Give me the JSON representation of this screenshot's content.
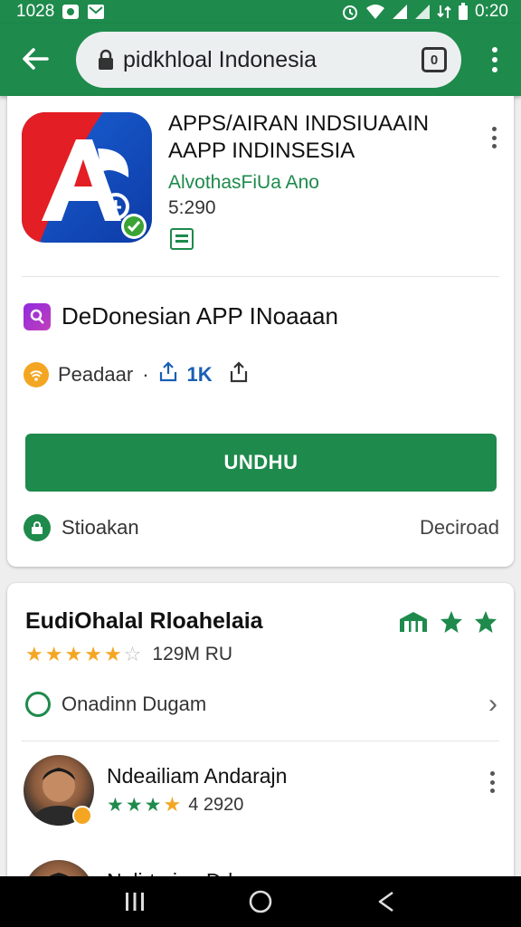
{
  "status_bar": {
    "left_time": "1028",
    "right_time": "0:20"
  },
  "toolbar": {
    "url": "pidkhloal Indonesia",
    "tabs_count": "0"
  },
  "app": {
    "title_line1": "APPS/AIRAN INDSIUAAIN",
    "title_line2": "AAPP INDINSESIA",
    "developer": "AlvothasFiUa Ano",
    "size": "5:290"
  },
  "developer_row": {
    "label": "DeDonesian APP INoaaan"
  },
  "meta_row": {
    "label": "Peadaar",
    "separator": "·",
    "stat": "1K"
  },
  "install_button": {
    "label": "UNDHU"
  },
  "bottom_row": {
    "left": "Stioakan",
    "right": "Deciroad"
  },
  "reviews": {
    "title": "EudiOhalal Rloahelaia",
    "rating": 4.5,
    "count_text": "129M RU",
    "link_label": "Onadinn Dugam",
    "reviewer_name": "Ndeailiam Andarajn",
    "reviewer_rating_value": "4 2920",
    "next_reviewer_name": "Nalirtzrian Ddaran"
  },
  "colors": {
    "brand_green": "#1e8a4c",
    "star_gold": "#f4a623"
  }
}
